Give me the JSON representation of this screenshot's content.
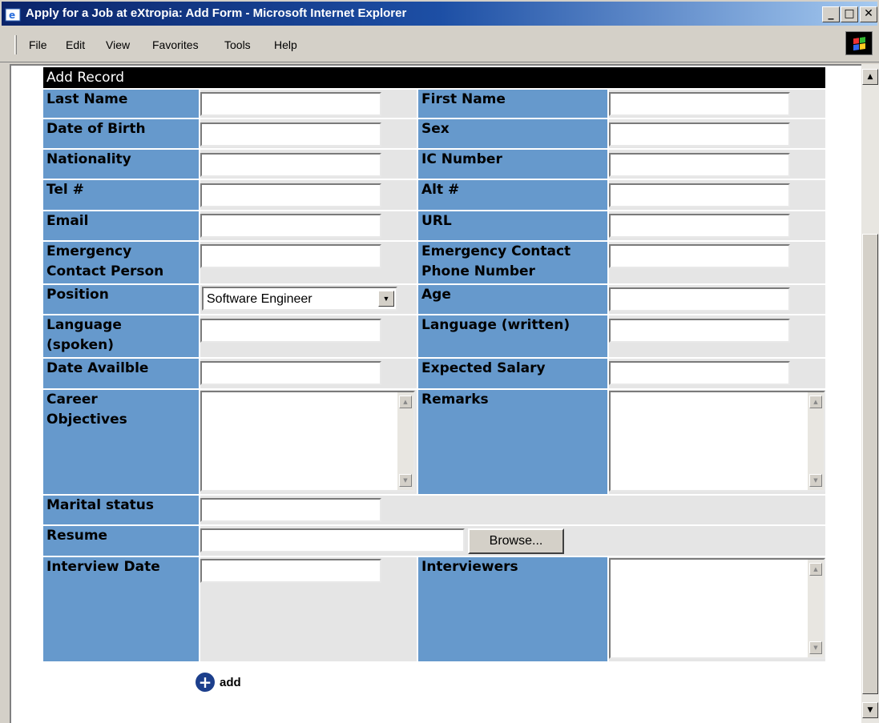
{
  "window": {
    "title": "Apply for a Job at eXtropia: Add Form - Microsoft Internet Explorer"
  },
  "menu": {
    "items": [
      "File",
      "Edit",
      "View",
      "Favorites",
      "Tools",
      "Help"
    ]
  },
  "form": {
    "header": "Add Record",
    "labels": {
      "last_name": "Last Name",
      "first_name": "First Name",
      "dob": "Date of Birth",
      "sex": "Sex",
      "nationality": "Nationality",
      "ic_number": "IC Number",
      "tel": "Tel #",
      "alt": "Alt #",
      "email": "Email",
      "url": "URL",
      "emerg_person_1": "Emergency",
      "emerg_person_2": "Contact Person",
      "emerg_phone_1": "Emergency Contact",
      "emerg_phone_2": "Phone Number",
      "position": "Position",
      "age": "Age",
      "lang_spoken_1": "Language",
      "lang_spoken_2": "(spoken)",
      "lang_written": "Language (written)",
      "date_available": "Date Availble",
      "expected_salary": "Expected Salary",
      "career_1": "Career",
      "career_2": "Objectives",
      "remarks": "Remarks",
      "marital": "Marital status",
      "resume": "Resume",
      "interview_date": "Interview Date",
      "interviewers": "Interviewers"
    },
    "position_value": "Software Engineer",
    "browse_label": "Browse...",
    "add_label": "add"
  },
  "colors": {
    "label_bg": "#6699cc",
    "field_bg": "#e5e5e5",
    "header_bg": "#000000"
  }
}
